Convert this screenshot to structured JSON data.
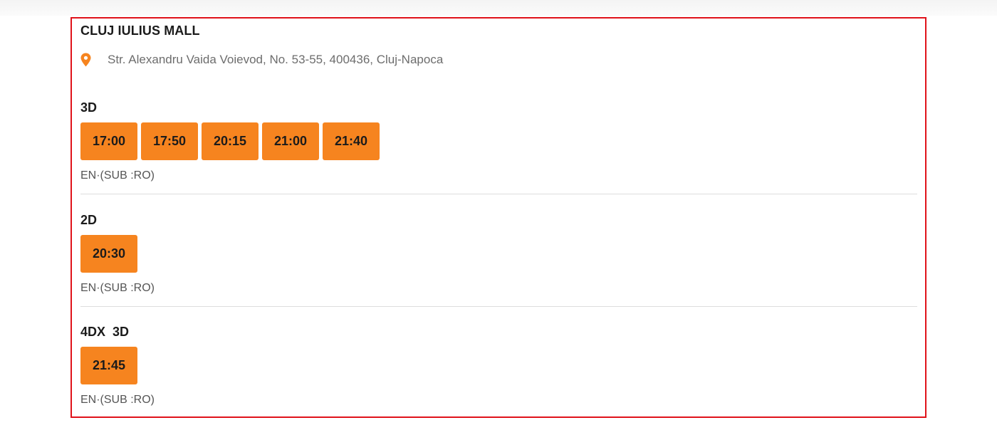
{
  "cinema": {
    "name": "CLUJ IULIUS MALL",
    "address": "Str. Alexandru Vaida Voievod, No. 53-55, 400436, Cluj-Napoca",
    "pin_icon": "map-pin-icon",
    "accent_color": "#f6841f",
    "border_color": "#e0121a"
  },
  "formats": [
    {
      "title": "3D",
      "times": [
        "17:00",
        "17:50",
        "20:15",
        "21:00",
        "21:40"
      ],
      "language": "EN·(SUB :RO)"
    },
    {
      "title": "2D",
      "times": [
        "20:30"
      ],
      "language": "EN·(SUB :RO)"
    },
    {
      "title": "4DX  3D",
      "times": [
        "21:45"
      ],
      "language": "EN·(SUB :RO)"
    }
  ]
}
